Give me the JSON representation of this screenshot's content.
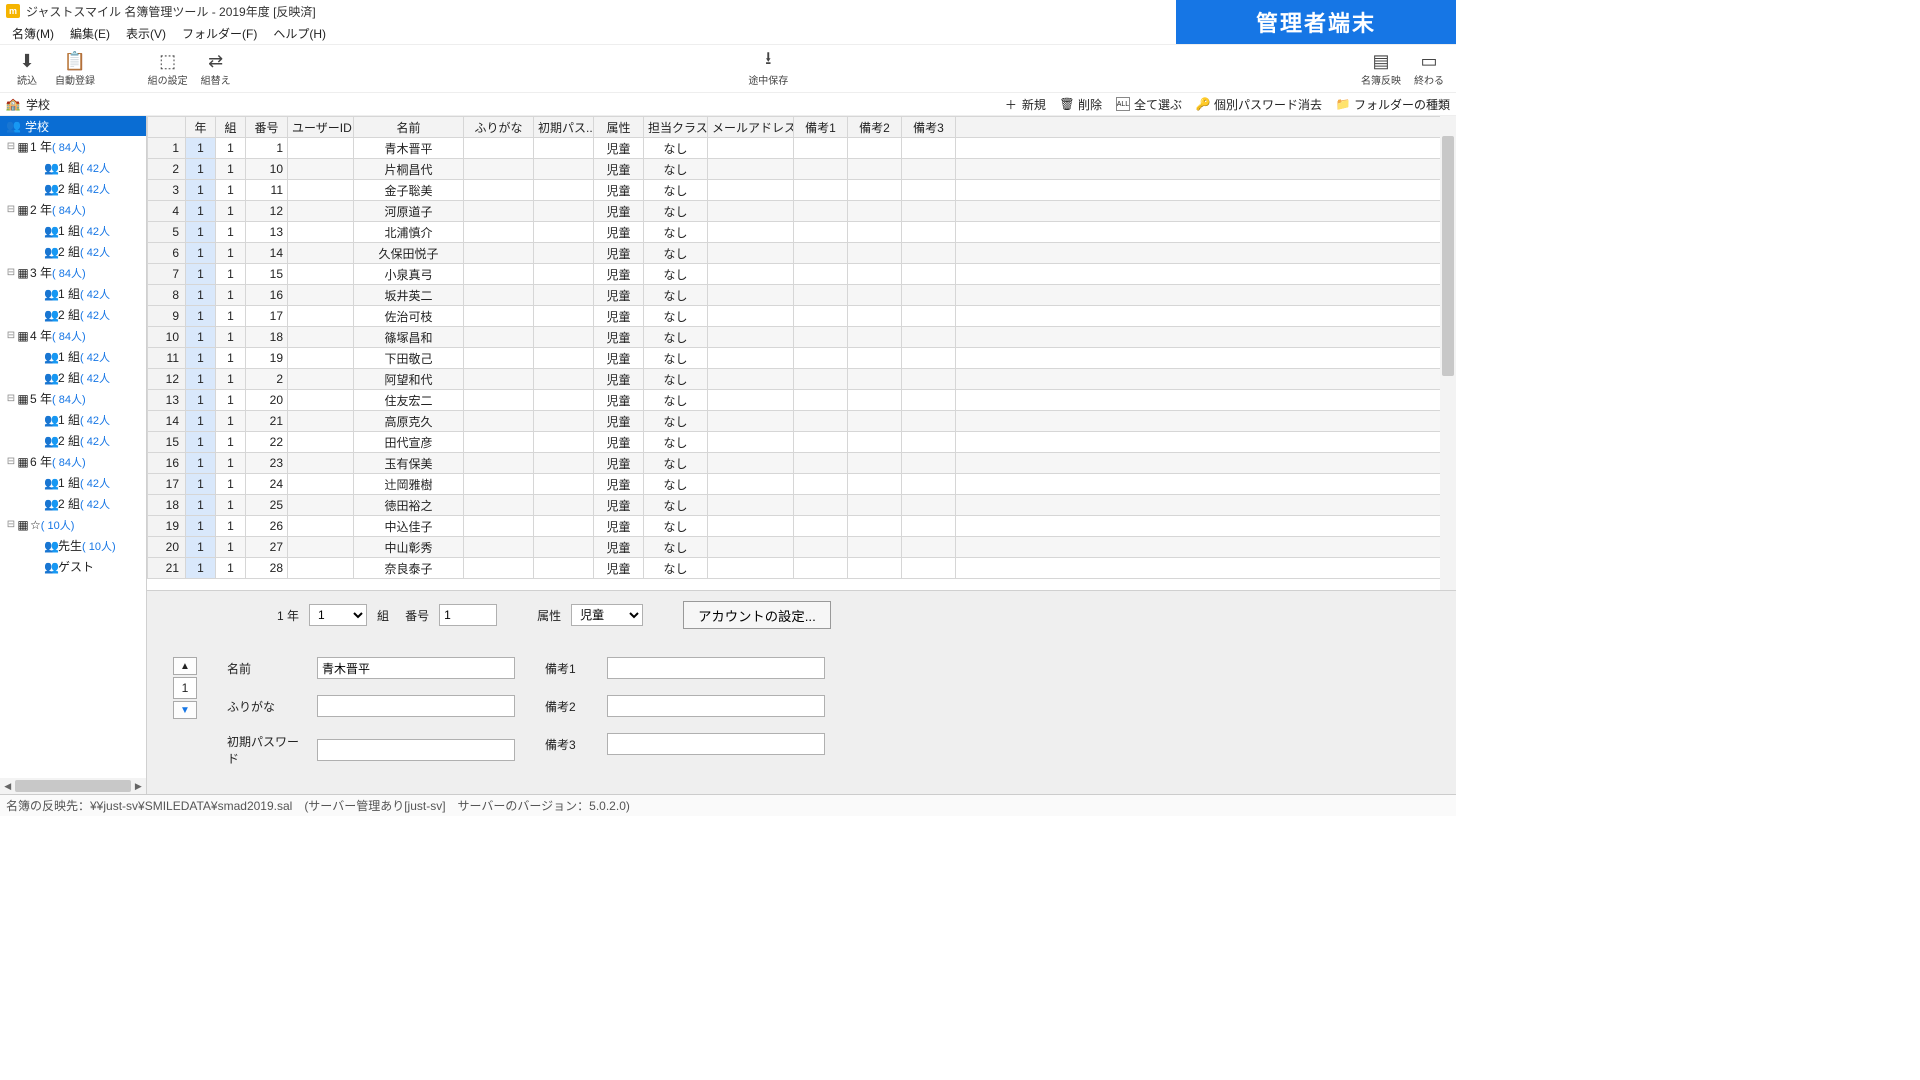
{
  "window": {
    "title": "ジャストスマイル 名簿管理ツール - 2019年度 [反映済]"
  },
  "banner": "管理者端末",
  "menu": [
    "名簿(M)",
    "編集(E)",
    "表示(V)",
    "フォルダー(F)",
    "ヘルプ(H)"
  ],
  "toolbar_left": [
    {
      "id": "import",
      "label": "読込",
      "icon": "⬇"
    },
    {
      "id": "autoreg",
      "label": "自動登録",
      "icon": "📋"
    }
  ],
  "toolbar_center": [
    {
      "id": "groupset",
      "label": "組の設定",
      "icon": "⬚"
    },
    {
      "id": "groupswap",
      "label": "組替え",
      "icon": "⇄"
    }
  ],
  "toolbar_center2": [
    {
      "id": "savewip",
      "label": "途中保存",
      "icon": "⭳"
    }
  ],
  "toolbar_right": [
    {
      "id": "reflect",
      "label": "名簿反映",
      "icon": "▤"
    },
    {
      "id": "exit",
      "label": "終わる",
      "icon": "▭"
    }
  ],
  "subbar": {
    "left": {
      "icon": "🏫",
      "label": "学校"
    },
    "right": [
      {
        "id": "new",
        "label": "新規",
        "icon": "＋"
      },
      {
        "id": "delete",
        "label": "削除",
        "icon": "🗑"
      },
      {
        "id": "selectall",
        "label": "全て選ぶ",
        "icon": "ALL"
      },
      {
        "id": "resetpw",
        "label": "個別パスワード消去",
        "icon": "🔑"
      },
      {
        "id": "catalog",
        "label": "フォルダーの種類",
        "icon": "📁"
      }
    ]
  },
  "tree": {
    "root": "学校",
    "grades": [
      {
        "yr": "1 年",
        "cnt": "( 84人)",
        "classes": [
          {
            "n": "1 組",
            "c": "( 42人"
          },
          {
            "n": "2 組",
            "c": "( 42人"
          }
        ]
      },
      {
        "yr": "2 年",
        "cnt": "( 84人)",
        "classes": [
          {
            "n": "1 組",
            "c": "( 42人"
          },
          {
            "n": "2 組",
            "c": "( 42人"
          }
        ]
      },
      {
        "yr": "3 年",
        "cnt": "( 84人)",
        "classes": [
          {
            "n": "1 組",
            "c": "( 42人"
          },
          {
            "n": "2 組",
            "c": "( 42人"
          }
        ]
      },
      {
        "yr": "4 年",
        "cnt": "( 84人)",
        "classes": [
          {
            "n": "1 組",
            "c": "( 42人"
          },
          {
            "n": "2 組",
            "c": "( 42人"
          }
        ]
      },
      {
        "yr": "5 年",
        "cnt": "( 84人)",
        "classes": [
          {
            "n": "1 組",
            "c": "( 42人"
          },
          {
            "n": "2 組",
            "c": "( 42人"
          }
        ]
      },
      {
        "yr": "6 年",
        "cnt": "( 84人)",
        "classes": [
          {
            "n": "1 組",
            "c": "( 42人"
          },
          {
            "n": "2 組",
            "c": "( 42人"
          }
        ]
      }
    ],
    "star": {
      "label": "☆",
      "cnt": "( 10人)"
    },
    "teachers": {
      "label": "先生",
      "cnt": "( 10人)"
    },
    "guest": "ゲスト"
  },
  "columns": [
    "",
    "年",
    "組",
    "番号",
    "ユーザーID",
    "名前",
    "ふりがな",
    "初期パス..",
    "属性",
    "担当クラス",
    "メールアドレス",
    "備考1",
    "備考2",
    "備考3"
  ],
  "rows": [
    {
      "i": 1,
      "y": 1,
      "g": 1,
      "no": 1,
      "name": "青木晋平",
      "attr": "児童",
      "cls": "なし"
    },
    {
      "i": 2,
      "y": 1,
      "g": 1,
      "no": 10,
      "name": "片桐昌代",
      "attr": "児童",
      "cls": "なし"
    },
    {
      "i": 3,
      "y": 1,
      "g": 1,
      "no": 11,
      "name": "金子聡美",
      "attr": "児童",
      "cls": "なし"
    },
    {
      "i": 4,
      "y": 1,
      "g": 1,
      "no": 12,
      "name": "河原道子",
      "attr": "児童",
      "cls": "なし"
    },
    {
      "i": 5,
      "y": 1,
      "g": 1,
      "no": 13,
      "name": "北浦慎介",
      "attr": "児童",
      "cls": "なし"
    },
    {
      "i": 6,
      "y": 1,
      "g": 1,
      "no": 14,
      "name": "久保田悦子",
      "attr": "児童",
      "cls": "なし"
    },
    {
      "i": 7,
      "y": 1,
      "g": 1,
      "no": 15,
      "name": "小泉真弓",
      "attr": "児童",
      "cls": "なし"
    },
    {
      "i": 8,
      "y": 1,
      "g": 1,
      "no": 16,
      "name": "坂井英二",
      "attr": "児童",
      "cls": "なし"
    },
    {
      "i": 9,
      "y": 1,
      "g": 1,
      "no": 17,
      "name": "佐治可枝",
      "attr": "児童",
      "cls": "なし"
    },
    {
      "i": 10,
      "y": 1,
      "g": 1,
      "no": 18,
      "name": "篠塚昌和",
      "attr": "児童",
      "cls": "なし"
    },
    {
      "i": 11,
      "y": 1,
      "g": 1,
      "no": 19,
      "name": "下田敬己",
      "attr": "児童",
      "cls": "なし"
    },
    {
      "i": 12,
      "y": 1,
      "g": 1,
      "no": 2,
      "name": "阿望和代",
      "attr": "児童",
      "cls": "なし"
    },
    {
      "i": 13,
      "y": 1,
      "g": 1,
      "no": 20,
      "name": "住友宏二",
      "attr": "児童",
      "cls": "なし"
    },
    {
      "i": 14,
      "y": 1,
      "g": 1,
      "no": 21,
      "name": "高原克久",
      "attr": "児童",
      "cls": "なし"
    },
    {
      "i": 15,
      "y": 1,
      "g": 1,
      "no": 22,
      "name": "田代宣彦",
      "attr": "児童",
      "cls": "なし"
    },
    {
      "i": 16,
      "y": 1,
      "g": 1,
      "no": 23,
      "name": "玉有保美",
      "attr": "児童",
      "cls": "なし"
    },
    {
      "i": 17,
      "y": 1,
      "g": 1,
      "no": 24,
      "name": "辻岡雅樹",
      "attr": "児童",
      "cls": "なし"
    },
    {
      "i": 18,
      "y": 1,
      "g": 1,
      "no": 25,
      "name": "徳田裕之",
      "attr": "児童",
      "cls": "なし"
    },
    {
      "i": 19,
      "y": 1,
      "g": 1,
      "no": 26,
      "name": "中込佳子",
      "attr": "児童",
      "cls": "なし"
    },
    {
      "i": 20,
      "y": 1,
      "g": 1,
      "no": 27,
      "name": "中山彰秀",
      "attr": "児童",
      "cls": "なし"
    },
    {
      "i": 21,
      "y": 1,
      "g": 1,
      "no": 28,
      "name": "奈良泰子",
      "attr": "児童",
      "cls": "なし"
    }
  ],
  "form": {
    "year": "1",
    "year_label": "年",
    "group_sel": "1",
    "group_label": "組",
    "no_label": "番号",
    "no_val": "1",
    "attr_label": "属性",
    "attr_sel": "児童",
    "act_btn": "アカウントの設定...",
    "spin_val": "1",
    "name_label": "名前",
    "name_val": "青木晋平",
    "kana_label": "ふりがな",
    "kana_val": "",
    "pw_label": "初期パスワード",
    "pw_val": "",
    "note1_label": "備考1",
    "note2_label": "備考2",
    "note3_label": "備考3",
    "note1": "",
    "note2": "",
    "note3": ""
  },
  "status": "名簿の反映先：¥¥just-sv¥SMILEDATA¥smad2019.sal　(サーバー管理あり[just-sv]　サーバーのバージョン：5.0.2.0)"
}
